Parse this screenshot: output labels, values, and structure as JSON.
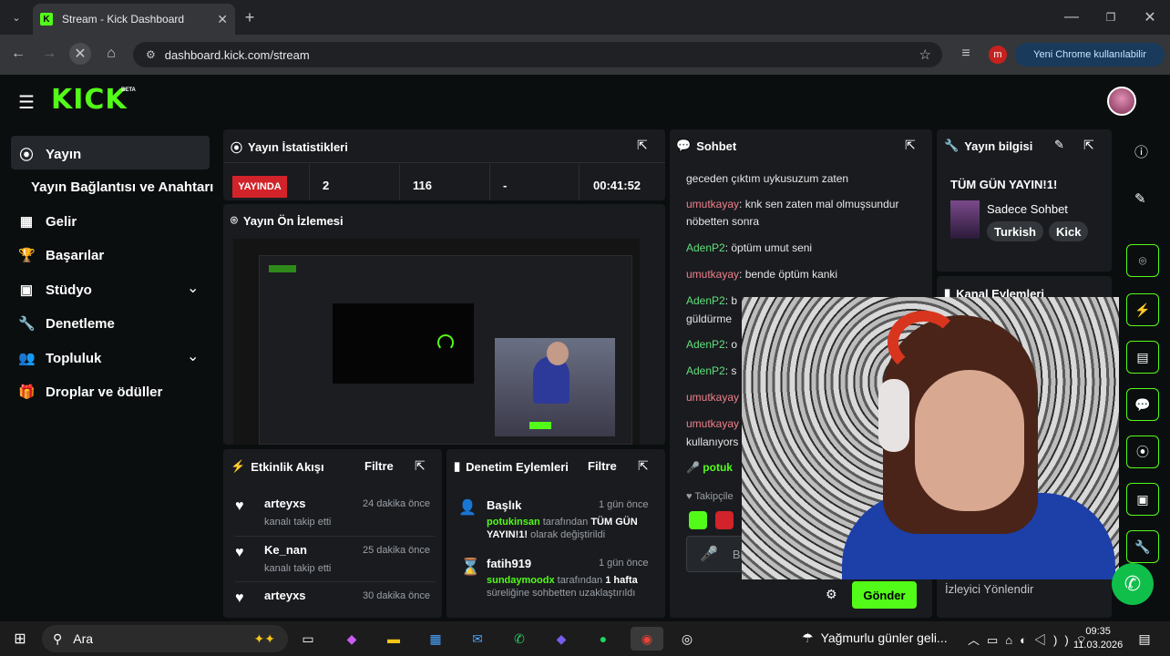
{
  "browser": {
    "tab_title": "Stream - Kick Dashboard",
    "new_tab": "+",
    "url": "dashboard.kick.com/stream",
    "new_chrome": "Yeni Chrome kullanılabilir",
    "profile_letter": "m"
  },
  "app": {
    "logo": "KICK",
    "logo_badge": "BETA"
  },
  "sidebar": {
    "items": [
      {
        "label": "Yayın",
        "icon": "broadcast-icon"
      },
      {
        "label": "Yayın Bağlantısı ve Anahtarı"
      },
      {
        "label": "Gelir",
        "icon": "chart-icon"
      },
      {
        "label": "Başarılar",
        "icon": "trophy-icon"
      },
      {
        "label": "Stüdyo",
        "icon": "studio-icon"
      },
      {
        "label": "Denetleme",
        "icon": "wrench-icon"
      },
      {
        "label": "Topluluk",
        "icon": "people-icon"
      },
      {
        "label": "Droplar ve ödüller",
        "icon": "gift-icon"
      }
    ]
  },
  "stats": {
    "title": "Yayın İstatistikleri",
    "live_badge": "YAYINDA",
    "viewers": "2",
    "followers": "116",
    "dash": "-",
    "uptime": "00:41:52"
  },
  "preview": {
    "title": "Yayın Ön İzlemesi"
  },
  "activity": {
    "title": "Etkinlik Akışı",
    "filter": "Filtre",
    "items": [
      {
        "user": "arteyxs",
        "action": "kanalı takip etti",
        "time": "24 dakika önce"
      },
      {
        "user": "Ke_nan",
        "action": "kanalı takip etti",
        "time": "25 dakika önce"
      },
      {
        "user": "arteyxs",
        "action": "kanalı takip etti",
        "time": "30 dakika önce"
      }
    ]
  },
  "moderation": {
    "title": "Denetim Eylemleri",
    "filter": "Filtre",
    "items": [
      {
        "title": "Başlık",
        "time": "1 gün önce",
        "actor": "potukinsan",
        "text_a": " tarafından ",
        "bold": "TÜM GÜN YAYIN!1!",
        "text_b": " olarak değiştirildi"
      },
      {
        "title": "fatih919",
        "time": "1 gün önce",
        "actor": "sundaymoodx",
        "text_a": " tarafından ",
        "bold": "1 hafta",
        "text_b": " süreliğine sohbetten uzaklaştırıldı"
      }
    ]
  },
  "chat": {
    "title": "Sohbet",
    "top_line": "geceden çıktım uykusuzum zaten",
    "messages": [
      {
        "user": "umutkayay",
        "text": ": knk sen zaten mal olmuşsundur nöbetten sonra",
        "color": "#f0808a"
      },
      {
        "user": "AdenP2",
        "text": ": öptüm umut seni",
        "color": "#5fe07a"
      },
      {
        "user": "umutkayay",
        "text": ": bende öptüm kanki",
        "color": "#f0808a"
      },
      {
        "user": "AdenP2",
        "text": ": b",
        "color": "#5fe07a"
      },
      {
        "user": "",
        "text": "güldürme",
        "color": "#e6e6e6"
      },
      {
        "user": "AdenP2",
        "text": ": o",
        "color": "#5fe07a"
      },
      {
        "user": "AdenP2",
        "text": ": s",
        "color": "#5fe07a"
      },
      {
        "user": "umutkayay",
        "text": "",
        "color": "#f0808a"
      },
      {
        "user": "umutkayay",
        "text": "",
        "color": "#f0808a"
      },
      {
        "user": "",
        "text": "kullanıyors",
        "color": "#e6e6e6"
      },
      {
        "user": "potuk",
        "text": "",
        "color": "#53fc18"
      }
    ],
    "followers_label": "Takipçile",
    "input_placeholder": "Bi",
    "send": "Gönder"
  },
  "info": {
    "title": "Yayın bilgisi",
    "stream_title": "TÜM GÜN YAYIN!1!",
    "category": "Sadece Sohbet",
    "tags": [
      "Turkish",
      "Kick"
    ],
    "actions_title": "Kanal Eylemleri",
    "redirect": "İzleyici Yönlendir"
  },
  "taskbar": {
    "search": "Ara",
    "weather": "Yağmurlu günler geli...",
    "time": "09:35",
    "date": "11.03.2026"
  }
}
